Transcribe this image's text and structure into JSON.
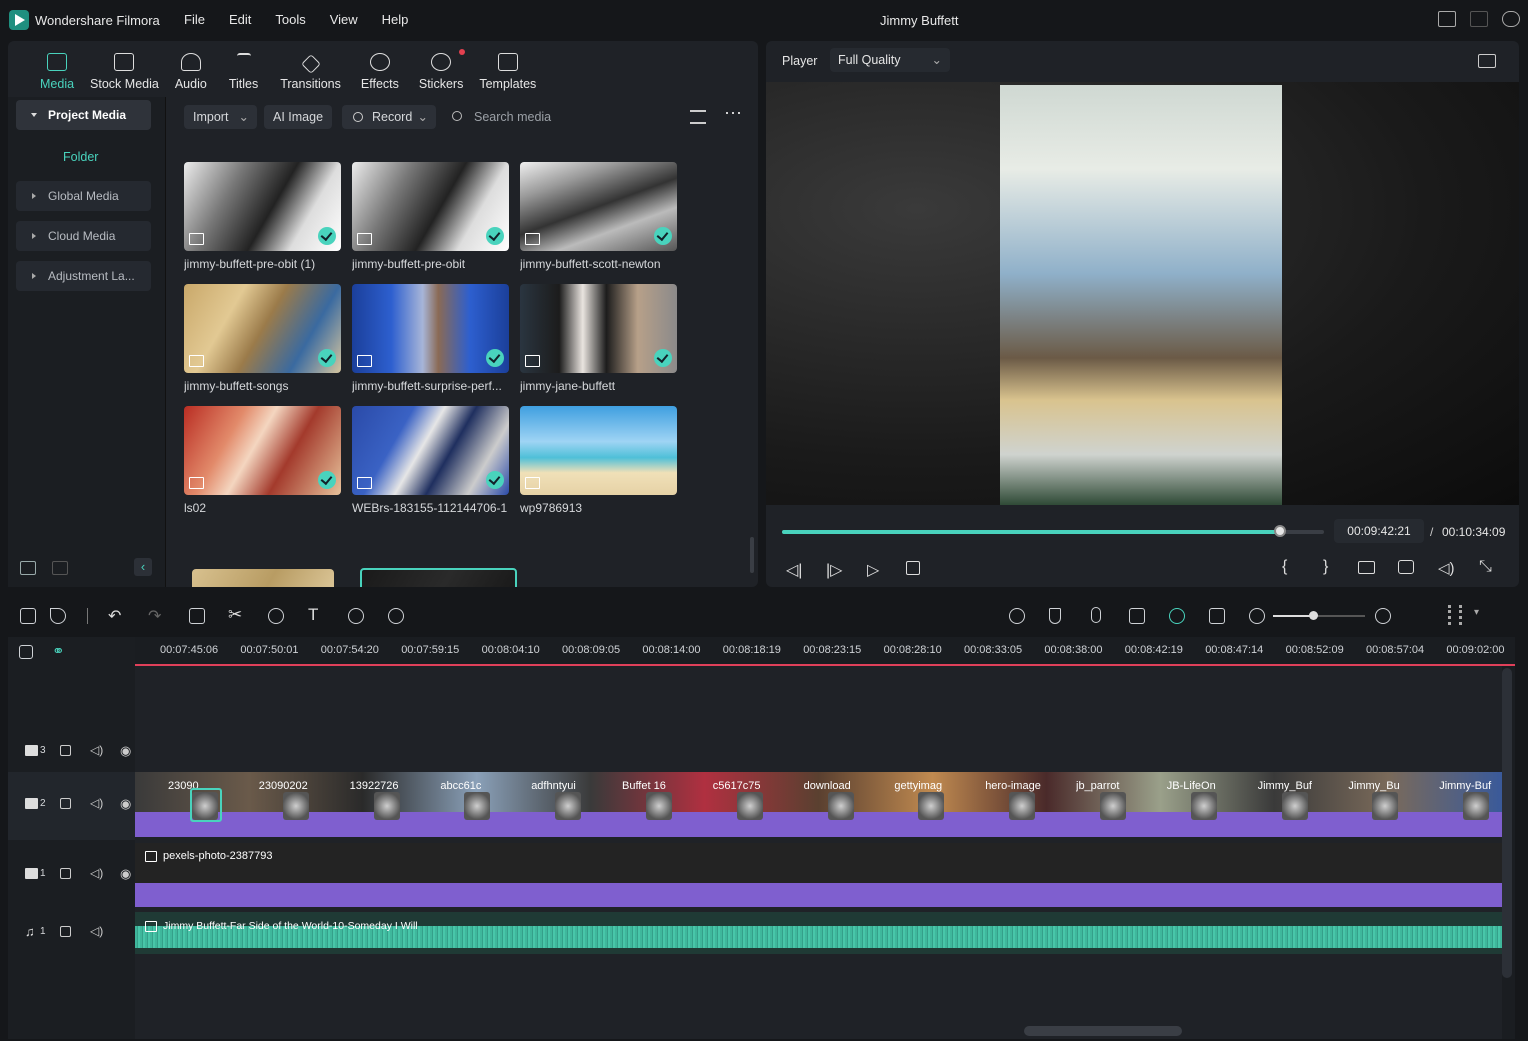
{
  "app": {
    "name": "Wondershare Filmora",
    "project_title": "Jimmy Buffett"
  },
  "menu": [
    "File",
    "Edit",
    "Tools",
    "View",
    "Help"
  ],
  "media_tabs": [
    {
      "label": "Media",
      "icon": "media-icon",
      "active": true
    },
    {
      "label": "Stock Media",
      "icon": "stock-media-icon"
    },
    {
      "label": "Audio",
      "icon": "music-note-icon"
    },
    {
      "label": "Titles",
      "icon": "text-t-icon"
    },
    {
      "label": "Transitions",
      "icon": "transitions-icon"
    },
    {
      "label": "Effects",
      "icon": "sparkle-icon"
    },
    {
      "label": "Stickers",
      "icon": "sticker-icon",
      "badge": true
    },
    {
      "label": "Templates",
      "icon": "template-icon"
    }
  ],
  "sidebar": {
    "project_media": "Project Media",
    "folder": "Folder",
    "items": [
      "Global Media",
      "Cloud Media",
      "Adjustment La..."
    ]
  },
  "media_toolbar": {
    "import": "Import",
    "ai_image": "AI Image",
    "record": "Record",
    "search_placeholder": "Search media"
  },
  "media_items": [
    {
      "name": "jimmy-buffett-pre-obit (1)",
      "checked": true
    },
    {
      "name": "jimmy-buffett-pre-obit",
      "checked": true
    },
    {
      "name": "jimmy-buffett-scott-newton",
      "checked": true
    },
    {
      "name": "jimmy-buffett-songs",
      "checked": true
    },
    {
      "name": "jimmy-buffett-surprise-perf...",
      "checked": true
    },
    {
      "name": "jimmy-jane-buffett",
      "checked": true
    },
    {
      "name": "ls02",
      "checked": true
    },
    {
      "name": "WEBrs-183155-112144706-1",
      "checked": true
    },
    {
      "name": "wp9786913",
      "checked": false
    }
  ],
  "player": {
    "label": "Player",
    "quality": "Full Quality",
    "current_time": "00:09:42:21",
    "separator": "/",
    "total_time": "00:10:34:09",
    "progress": 0.9187
  },
  "ruler": [
    "00:07:45:06",
    "00:07:50:01",
    "00:07:54:20",
    "00:07:59:15",
    "00:08:04:10",
    "00:08:09:05",
    "00:08:14:00",
    "00:08:18:19",
    "00:08:23:15",
    "00:08:28:10",
    "00:08:33:05",
    "00:08:38:00",
    "00:08:42:19",
    "00:08:47:14",
    "00:08:52:09",
    "00:08:57:04",
    "00:09:02:00"
  ],
  "tracks": {
    "video3": "3",
    "video2": "2",
    "video1": "1",
    "audio1": "1",
    "video2_clips": [
      "23090",
      "23090202",
      "13922726",
      "abcc61c",
      "adfhntyui",
      "Buffet 16",
      "c5617c75",
      "download",
      "gettyimag",
      "hero-image",
      "jb_parrot",
      "JB-LifeOn",
      "Jimmy_Buf",
      "Jimmy_Bu",
      "Jimmy-Buf"
    ],
    "video1_clip": "pexels-photo-2387793",
    "audio1_clip": "Jimmy Buffett-Far Side of the World-10-Someday I Will"
  },
  "colors": {
    "accent": "#49d3bd",
    "clip_purple": "#7f5fcf",
    "audio_green": "#3fb79c",
    "playhead": "#e0405a"
  }
}
